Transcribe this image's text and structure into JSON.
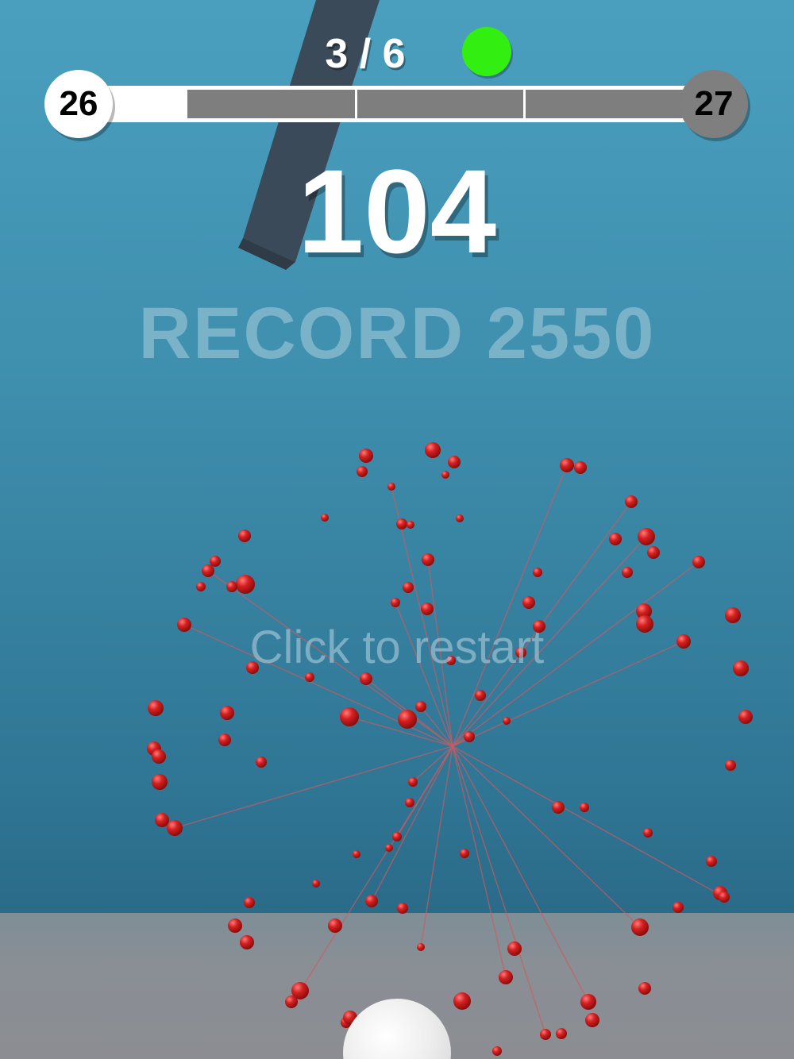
{
  "hud": {
    "stage_label": "3 / 6",
    "status_color": "#33ee11",
    "level_current": "26",
    "level_next": "27",
    "level_progress_fraction": 0.17,
    "progress_segments": 3,
    "score": "104",
    "record_label": "RECORD 2550",
    "restart_label": "Click to restart"
  },
  "colors": {
    "sky_top": "#4a9fbf",
    "sky_bottom": "#2a6b88",
    "floor": "#8a8f95",
    "pillar": "#3b4a58",
    "particle": "#d42020",
    "player_ball": "#f2f2f2"
  }
}
